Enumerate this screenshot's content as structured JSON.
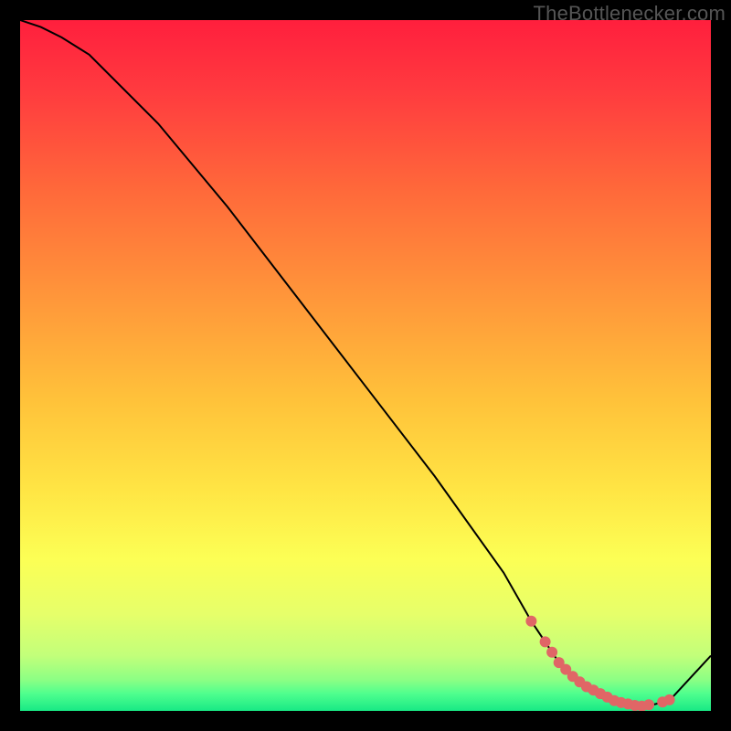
{
  "watermark_text": "TheBottlenecker.com",
  "chart_data": {
    "type": "line",
    "title": "",
    "xlabel": "",
    "ylabel": "",
    "xlim": [
      0,
      100
    ],
    "ylim": [
      0,
      100
    ],
    "series": [
      {
        "name": "curve",
        "x": [
          0,
          3,
          6,
          10,
          20,
          30,
          40,
          50,
          60,
          70,
          74,
          78,
          82,
          86,
          90,
          94,
          100
        ],
        "y": [
          100,
          99,
          97.5,
          95,
          85,
          73,
          60,
          47,
          34,
          20,
          13,
          7,
          3,
          1,
          0.5,
          1.5,
          8
        ]
      }
    ],
    "markers": {
      "name": "highlighted-points",
      "x": [
        74,
        76,
        77,
        78,
        79,
        80,
        81,
        82,
        83,
        84,
        85,
        86,
        87,
        88,
        89,
        90,
        91,
        93,
        94
      ],
      "y": [
        13,
        10,
        8.5,
        7,
        6,
        5,
        4.2,
        3.5,
        3,
        2.5,
        2,
        1.5,
        1.2,
        1,
        0.8,
        0.7,
        0.9,
        1.3,
        1.6
      ]
    },
    "gradient_stops": [
      {
        "offset": 0.0,
        "color": "#ff1f3d"
      },
      {
        "offset": 0.1,
        "color": "#ff3a3f"
      },
      {
        "offset": 0.25,
        "color": "#ff6a3a"
      },
      {
        "offset": 0.4,
        "color": "#ff963a"
      },
      {
        "offset": 0.55,
        "color": "#ffc23a"
      },
      {
        "offset": 0.68,
        "color": "#ffe544"
      },
      {
        "offset": 0.78,
        "color": "#fcff55"
      },
      {
        "offset": 0.86,
        "color": "#e6ff6a"
      },
      {
        "offset": 0.92,
        "color": "#c2ff7a"
      },
      {
        "offset": 0.955,
        "color": "#8cff84"
      },
      {
        "offset": 0.975,
        "color": "#4fff8e"
      },
      {
        "offset": 1.0,
        "color": "#18e985"
      }
    ],
    "marker_color": "#e06666",
    "curve_color": "#000000"
  }
}
